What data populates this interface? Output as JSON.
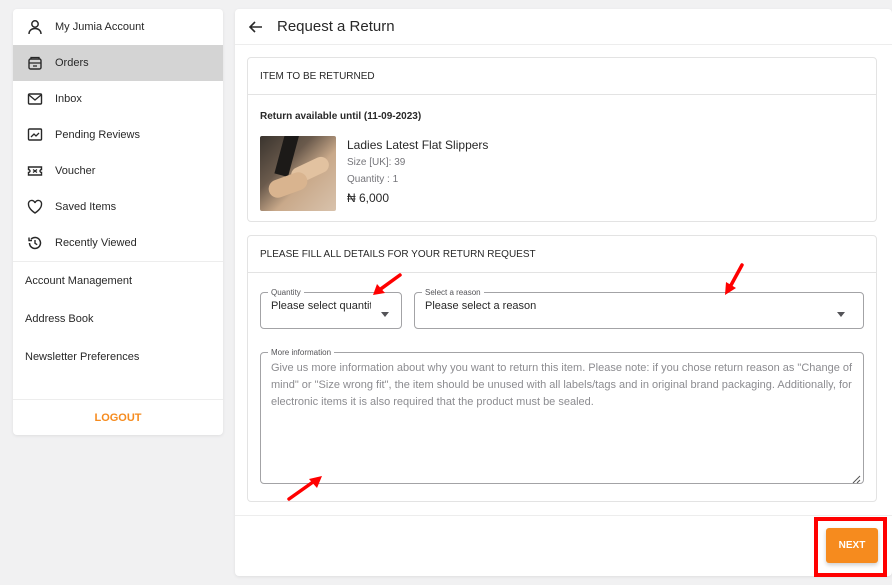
{
  "sidebar": {
    "items": [
      {
        "label": "My Jumia Account",
        "icon": "user-icon"
      },
      {
        "label": "Orders",
        "icon": "orders-icon",
        "active": true
      },
      {
        "label": "Inbox",
        "icon": "mail-icon"
      },
      {
        "label": "Pending Reviews",
        "icon": "review-icon"
      },
      {
        "label": "Voucher",
        "icon": "voucher-icon"
      },
      {
        "label": "Saved Items",
        "icon": "heart-icon"
      },
      {
        "label": "Recently Viewed",
        "icon": "history-icon"
      }
    ],
    "links": [
      "Account Management",
      "Address Book",
      "Newsletter Preferences"
    ],
    "logout": "LOGOUT"
  },
  "header": {
    "title": "Request a Return"
  },
  "item_card": {
    "heading": "ITEM TO BE RETURNED",
    "availability": "Return available until (11-09-2023)",
    "product": {
      "name": "Ladies Latest Flat Slippers",
      "size": "Size [UK]: 39",
      "quantity": "Quantity : 1",
      "price": "₦ 6,000"
    }
  },
  "details_card": {
    "heading": "PLEASE FILL ALL DETAILS FOR YOUR RETURN REQUEST",
    "quantity_field": {
      "legend": "Quantity",
      "value": "Please select quantity"
    },
    "reason_field": {
      "legend": "Select a reason",
      "value": "Please select a reason"
    },
    "more_field": {
      "legend": "More information",
      "placeholder": "Give us more information about why you want to return this item. Please note: if you chose return reason as \"Change of mind\" or \"Size wrong fit\", the item should be unused with all labels/tags and in original brand packaging. Additionally, for electronic items it is also required that the product must be sealed."
    }
  },
  "footer": {
    "next_label": "NEXT"
  },
  "colors": {
    "accent": "#f68b1e",
    "annotation": "#ff0000"
  }
}
